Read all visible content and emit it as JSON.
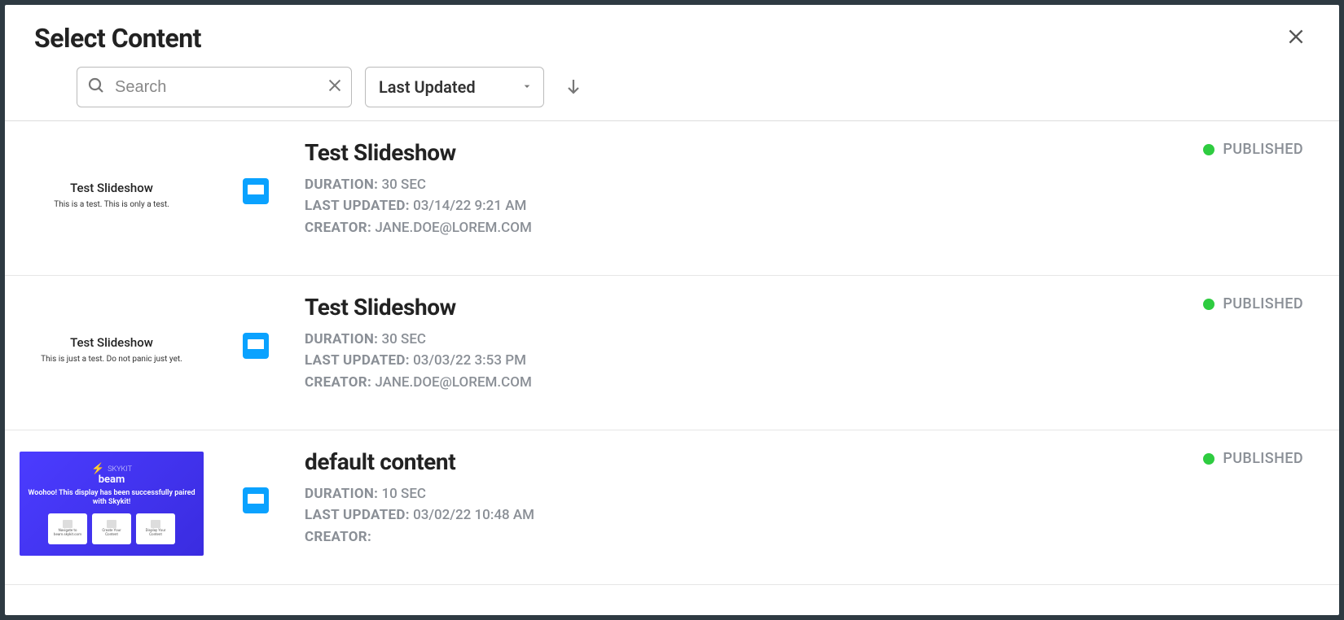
{
  "modal": {
    "title": "Select Content"
  },
  "search": {
    "placeholder": "Search",
    "value": ""
  },
  "sort": {
    "selected": "Last Updated"
  },
  "labels": {
    "duration": "DURATION:",
    "last_updated": "LAST UPDATED:",
    "creator": "CREATOR:"
  },
  "status_labels": {
    "published": "PUBLISHED"
  },
  "items": [
    {
      "title": "Test Slideshow",
      "duration": "30 SEC",
      "last_updated": "03/14/22 9:21 AM",
      "creator": "JANE.DOE@LOREM.COM",
      "status": "PUBLISHED",
      "thumb_title": "Test Slideshow",
      "thumb_sub": "This is a test. This is only a test.",
      "thumb_kind": "text"
    },
    {
      "title": "Test Slideshow",
      "duration": "30 SEC",
      "last_updated": "03/03/22 3:53 PM",
      "creator": "JANE.DOE@LOREM.COM",
      "status": "PUBLISHED",
      "thumb_title": "Test Slideshow",
      "thumb_sub": "This is just a test. Do not panic just yet.",
      "thumb_kind": "text"
    },
    {
      "title": "default content",
      "duration": "10 SEC",
      "last_updated": "03/02/22 10:48 AM",
      "creator": "",
      "status": "PUBLISHED",
      "thumb_title": "beam",
      "thumb_sub": "Woohoo! This display has been successfully paired with Skykit!",
      "thumb_kind": "beam"
    }
  ]
}
